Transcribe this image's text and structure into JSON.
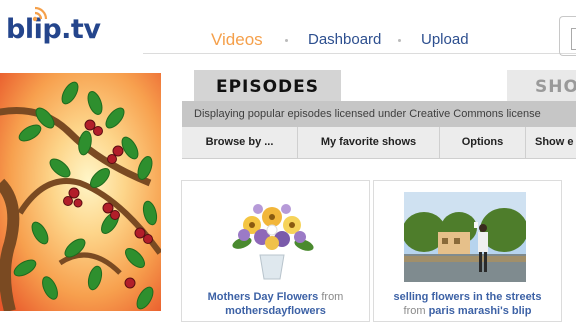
{
  "header": {
    "logo_text": "blip.tv",
    "nav": {
      "videos": "Videos",
      "dashboard": "Dashboard",
      "upload": "Upload"
    }
  },
  "tabs": {
    "episodes": "EPISODES",
    "shows": "SHOW"
  },
  "info_text": "Displaying popular episodes licensed under Creative Commons license",
  "subnav": {
    "browse": "Browse by ...",
    "favorites": "My favorite shows",
    "options": "Options",
    "show_e": "Show e"
  },
  "cards": [
    {
      "title": "Mothers Day Flowers",
      "from": "from",
      "by": "mothersdayflowers"
    },
    {
      "title": "selling flowers in the streets",
      "from": "from",
      "by": "paris marashi's blip"
    }
  ],
  "colors": {
    "accent_orange": "#f5a04b",
    "link_blue": "#2d4f8f",
    "logo_blue": "#24458c"
  }
}
